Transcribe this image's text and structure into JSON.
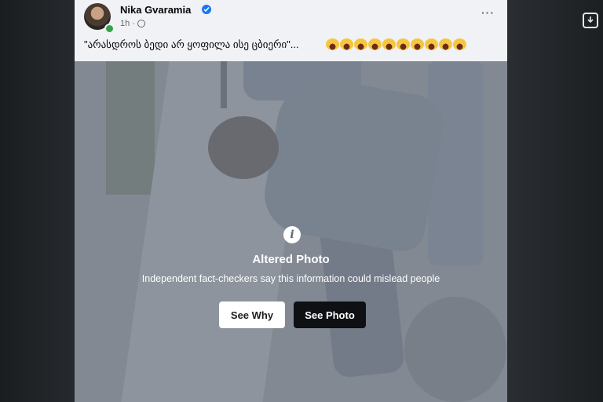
{
  "post": {
    "author": "Nika Gvaramia",
    "time": "1h",
    "caption": "\"არასდროს ბედი არ ყოფილა ისე ცბიერი\"...",
    "emoji_count": 10,
    "more_label": "···"
  },
  "warning": {
    "icon": "info-icon",
    "title": "Altered Photo",
    "text": "Independent fact-checkers say this information could mislead people",
    "see_why_label": "See Why",
    "see_photo_label": "See Photo"
  },
  "colors": {
    "verified": "#1877f2",
    "online": "#31a24c",
    "button_dark": "#0f1013"
  }
}
